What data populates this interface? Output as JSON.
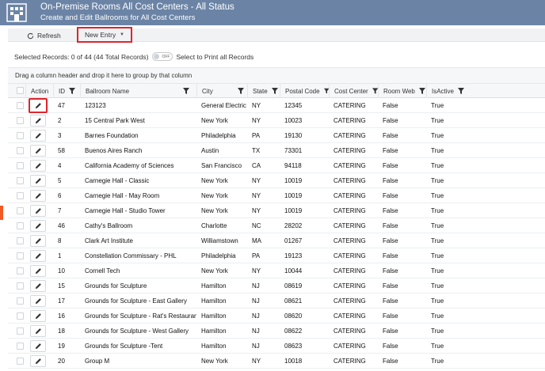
{
  "header": {
    "title": "On-Premise Rooms All Cost Centers - All Status",
    "subtitle": "Create and Edit Ballrooms for All Cost Centers",
    "logo_icon": "building-icon"
  },
  "toolbar": {
    "refresh_label": "Refresh",
    "new_entry_label": "New Entry",
    "highlight_color": "#e0242c"
  },
  "selection": {
    "text": "Selected Records: 0 of 44 (44 Total Records)",
    "toggle_text": "OFF",
    "toggle_label": "Select to Print all Records"
  },
  "group_hint": "Drag a column header and drop it here to group by that column",
  "columns": [
    "Action",
    "ID",
    "Ballroom Name",
    "City",
    "State",
    "Postal Code",
    "Cost Center",
    "Room Web",
    "IsActive"
  ],
  "rows": [
    {
      "id": "47",
      "name": "123123",
      "city": "General Electric",
      "state": "NY",
      "postal": "12345",
      "cost_center": "CATERING",
      "room_web": "False",
      "active": "True"
    },
    {
      "id": "2",
      "name": "15 Central Park West",
      "city": "New York",
      "state": "NY",
      "postal": "10023",
      "cost_center": "CATERING",
      "room_web": "False",
      "active": "True"
    },
    {
      "id": "3",
      "name": "Barnes Foundation",
      "city": "Philadelphia",
      "state": "PA",
      "postal": "19130",
      "cost_center": "CATERING",
      "room_web": "False",
      "active": "True"
    },
    {
      "id": "58",
      "name": "Buenos Aires Ranch",
      "city": "Austin",
      "state": "TX",
      "postal": "73301",
      "cost_center": "CATERING",
      "room_web": "False",
      "active": "True"
    },
    {
      "id": "4",
      "name": "California Academy of Sciences",
      "city": "San Francisco",
      "state": "CA",
      "postal": "94118",
      "cost_center": "CATERING",
      "room_web": "False",
      "active": "True"
    },
    {
      "id": "5",
      "name": "Carnegie Hall - Classic",
      "city": "New York",
      "state": "NY",
      "postal": "10019",
      "cost_center": "CATERING",
      "room_web": "False",
      "active": "True"
    },
    {
      "id": "6",
      "name": "Carnegie Hall - May Room",
      "city": "New York",
      "state": "NY",
      "postal": "10019",
      "cost_center": "CATERING",
      "room_web": "False",
      "active": "True"
    },
    {
      "id": "7",
      "name": "Carnegie Hall - Studio Tower",
      "city": "New York",
      "state": "NY",
      "postal": "10019",
      "cost_center": "CATERING",
      "room_web": "False",
      "active": "True"
    },
    {
      "id": "46",
      "name": "Cathy's Ballroom",
      "city": "Charlotte",
      "state": "NC",
      "postal": "28202",
      "cost_center": "CATERING",
      "room_web": "False",
      "active": "True"
    },
    {
      "id": "8",
      "name": "Clark Art Institute",
      "city": "Williamstown",
      "state": "MA",
      "postal": "01267",
      "cost_center": "CATERING",
      "room_web": "False",
      "active": "True"
    },
    {
      "id": "1",
      "name": "Constellation Commissary - PHL",
      "city": "Philadelphia",
      "state": "PA",
      "postal": "19123",
      "cost_center": "CATERING",
      "room_web": "False",
      "active": "True"
    },
    {
      "id": "10",
      "name": "Cornell Tech",
      "city": "New York",
      "state": "NY",
      "postal": "10044",
      "cost_center": "CATERING",
      "room_web": "False",
      "active": "True"
    },
    {
      "id": "15",
      "name": "Grounds for Sculpture",
      "city": "Hamilton",
      "state": "NJ",
      "postal": "08619",
      "cost_center": "CATERING",
      "room_web": "False",
      "active": "True"
    },
    {
      "id": "17",
      "name": "Grounds for Sculpture - East Gallery",
      "city": "Hamilton",
      "state": "NJ",
      "postal": "08621",
      "cost_center": "CATERING",
      "room_web": "False",
      "active": "True"
    },
    {
      "id": "16",
      "name": "Grounds for Sculpture - Rat's Restaurant",
      "city": "Hamilton",
      "state": "NJ",
      "postal": "08620",
      "cost_center": "CATERING",
      "room_web": "False",
      "active": "True"
    },
    {
      "id": "18",
      "name": "Grounds for Sculpture - West Gallery",
      "city": "Hamilton",
      "state": "NJ",
      "postal": "08622",
      "cost_center": "CATERING",
      "room_web": "False",
      "active": "True"
    },
    {
      "id": "19",
      "name": "Grounds for Sculpture -Tent",
      "city": "Hamilton",
      "state": "NJ",
      "postal": "08623",
      "cost_center": "CATERING",
      "room_web": "False",
      "active": "True"
    },
    {
      "id": "20",
      "name": "Group M",
      "city": "New York",
      "state": "NY",
      "postal": "10018",
      "cost_center": "CATERING",
      "room_web": "False",
      "active": "True"
    }
  ]
}
